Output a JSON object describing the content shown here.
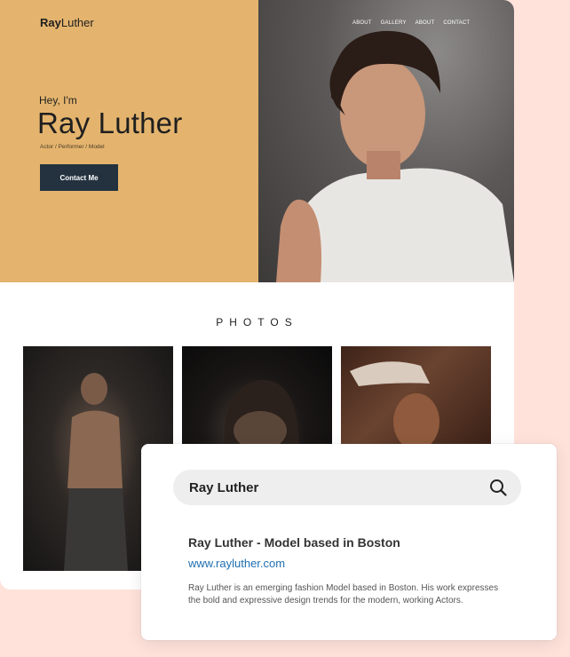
{
  "site": {
    "logo": {
      "bold": "Ray",
      "rest": "Luther"
    },
    "nav": [
      "ABOUT",
      "GALLERY",
      "ABOUT",
      "CONTACT"
    ],
    "hero": {
      "greeting": "Hey, I'm",
      "name": "Ray Luther",
      "roles": "Actor / Performer / Model",
      "cta": "Contact Me"
    },
    "photos_title": "PHOTOS"
  },
  "search_card": {
    "query": "Ray Luther",
    "result": {
      "title": "Ray Luther - Model based in Boston",
      "url": "www.rayluther.com",
      "description": "Ray Luther is an emerging fashion Model based in Boston. His work expresses the bold and expressive design trends for the modern, working Actors."
    }
  },
  "colors": {
    "background": "#ffe3db",
    "hero_accent": "#e4b46e",
    "button": "#243240",
    "link": "#1f6fb1"
  }
}
